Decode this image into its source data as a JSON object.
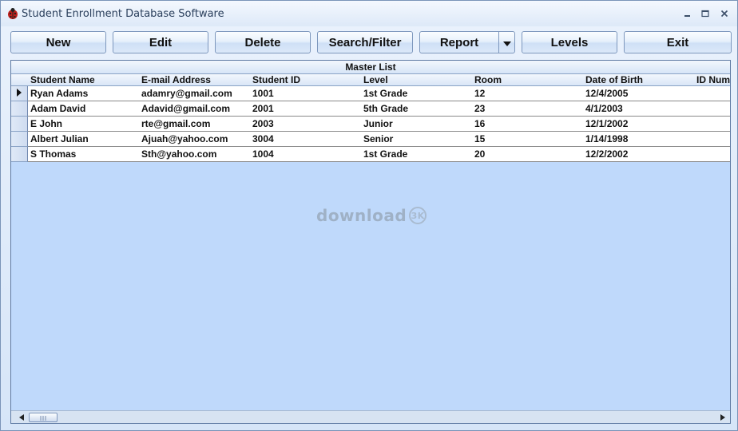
{
  "window": {
    "title": "Student Enrollment Database Software",
    "app_icon": "ladybug-icon",
    "controls": [
      "minimize-icon",
      "maximize-icon",
      "close-icon"
    ]
  },
  "toolbar": {
    "new_label": "New",
    "edit_label": "Edit",
    "delete_label": "Delete",
    "search_label": "Search/Filter",
    "report_label": "Report",
    "levels_label": "Levels",
    "exit_label": "Exit"
  },
  "grid": {
    "title": "Master List",
    "columns": [
      "Student Name",
      "E-mail Address",
      "Student ID",
      "Level",
      "Room",
      "Date of Birth",
      "ID Num"
    ],
    "rows": [
      [
        "Ryan Adams",
        "adamry@gmail.com",
        "1001",
        "1st Grade",
        "12",
        "12/4/2005",
        ""
      ],
      [
        "Adam David",
        "Adavid@gmail.com",
        "2001",
        "5th Grade",
        "23",
        "4/1/2003",
        ""
      ],
      [
        "E John",
        "rte@gmail.com",
        "2003",
        "Junior",
        "16",
        "12/1/2002",
        ""
      ],
      [
        "Albert Julian",
        "Ajuah@yahoo.com",
        "3004",
        "Senior",
        "15",
        "1/14/1998",
        ""
      ],
      [
        "S Thomas",
        "Sth@yahoo.com",
        "1004",
        "1st Grade",
        "20",
        "12/2/2002",
        ""
      ]
    ],
    "current_row": 0
  },
  "watermark": {
    "text": "download",
    "badge": "3K"
  },
  "colors": {
    "grid_background": "#bfd9fb",
    "window_background": "#dbe8f9"
  }
}
